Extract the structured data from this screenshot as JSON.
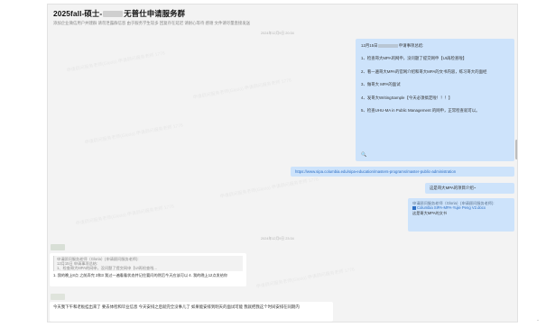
{
  "header": {
    "title_prefix": "2025fall-硕士-",
    "title_suffix": "无普仕申请服务群",
    "subtitle": "添加企业微信用户并建群 请勿泄露群信息 由于服务学生较多 回复存在延迟 请耐心等待 感谢 文件请尽量直接发送"
  },
  "timestamps": {
    "t1": "2024年12月9日 20:34",
    "t2": "2024年12月9日 23:34"
  },
  "my_message_main": {
    "lines": [
      "12月15日 申请事项总结:",
      "1、检查哥大MPA的网申，没问题了提交网申【UI再检查啦】",
      "2、看一遍哥大MPA的官网介绍和哥大MPA的文书内容，练习哥大的面经",
      "3、做哥大 MPA的面试",
      "4、发哥大WritingSample【今天必须搞定啦！！！】",
      "5、检查UHU-MA in Public Management 的网申，正常检查就可以。"
    ],
    "bottom_glyph": "🔍"
  },
  "link_message": {
    "url": "https://www.sipa.columbia.edu/sipa-education/masters-programs/master-public-administration"
  },
  "q1_message": {
    "text": "这是哥大MPA的项目介绍~"
  },
  "quoted_message": {
    "quote_header": "申请顾问服务老师（Gloria）(申请顾问服务老师):",
    "file_name": "Columbia SIPA-MPA-Yujie Peng V2.docx",
    "text": "这是哥大MPA的文书"
  },
  "reply_message": {
    "quote_lines": [
      "申请顾问服务老师（Gloria）(申请顾问服务老师):",
      "12月15日 申请事项总结:",
      "1、检查哥大MPA的网申，没问题了提交网申【UI再检查啦..."
    ],
    "text": "1. 我的晚上8点 之前弄完 2和3 我过一遍看看状态并记住要问的然后今天应该可以 4. 我的晚上12点发给你"
  },
  "last_message": {
    "text": "今天我下午和老板挂出来了 要去体检和毕业信息 今天安排之后就完全没事儿了 如果能安排到明天的面试可能 我就把我这个时间安排在同期内"
  },
  "watermark": "申请顾问服务老师(Gloria) 申请顾问服务老师 1776",
  "corner_mark": "·"
}
